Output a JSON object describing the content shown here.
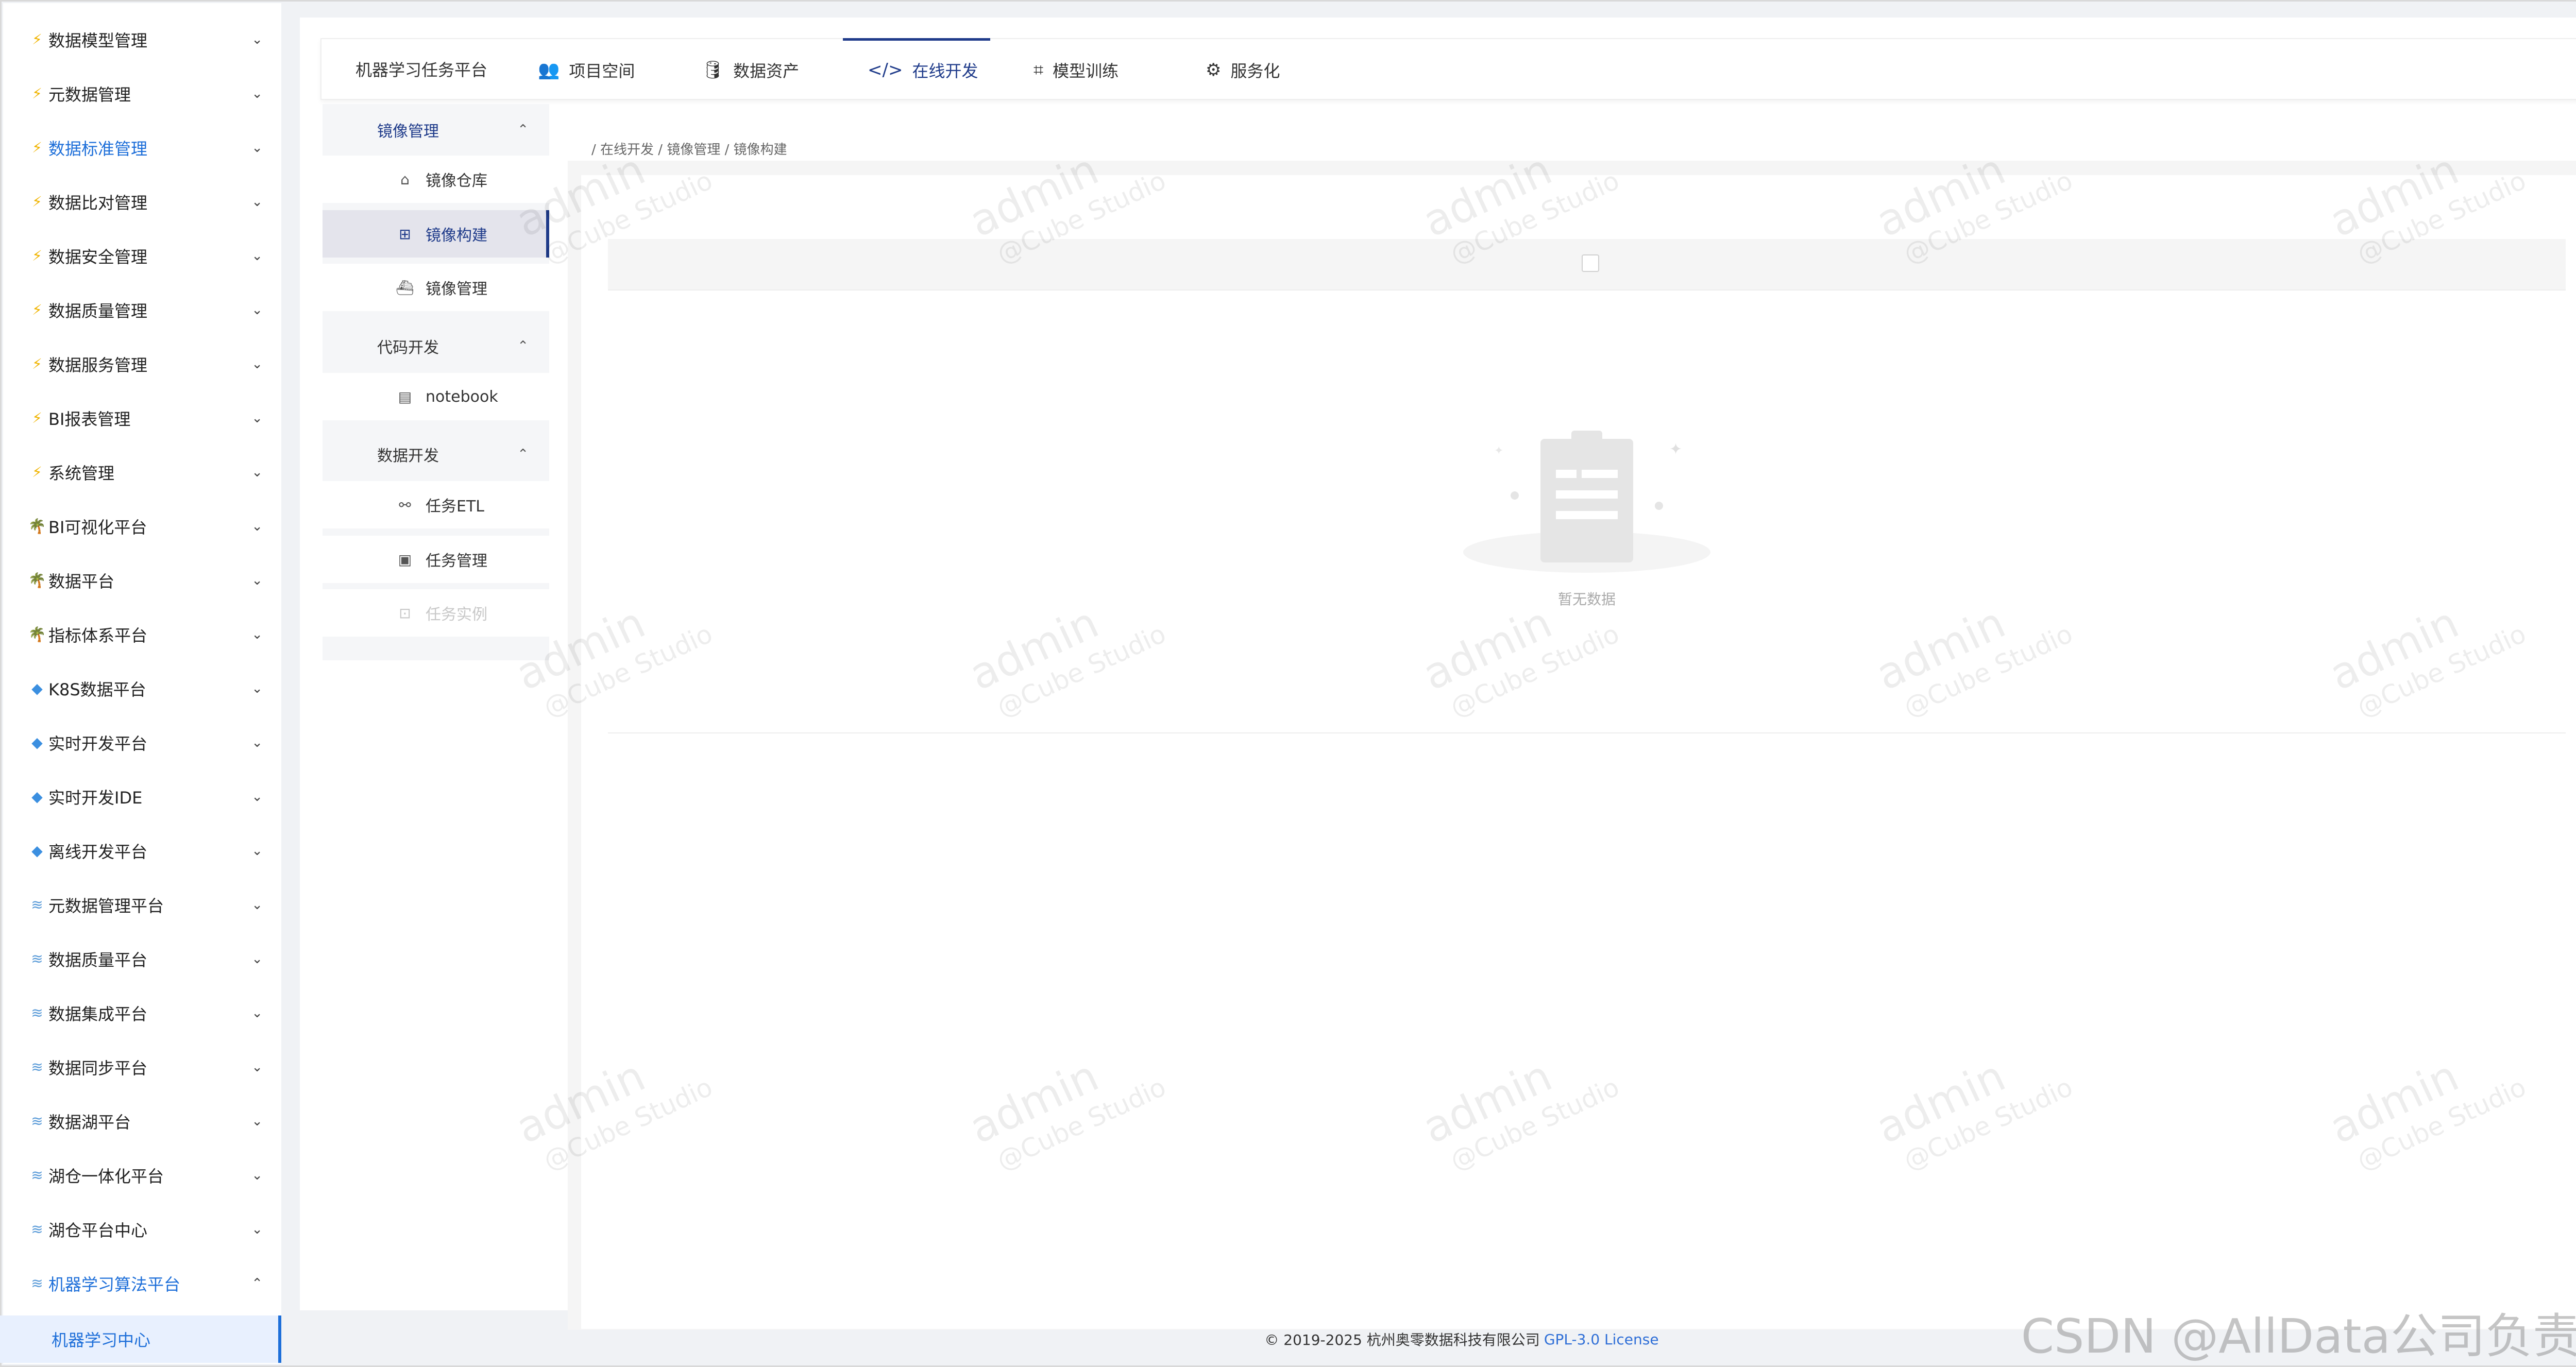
{
  "sidebar": {
    "items": [
      {
        "label": "数据模型管理",
        "icon": "lightning-icon"
      },
      {
        "label": "元数据管理",
        "icon": "lightning-icon"
      },
      {
        "label": "数据标准管理",
        "icon": "lightning-icon"
      },
      {
        "label": "数据比对管理",
        "icon": "lightning-icon"
      },
      {
        "label": "数据安全管理",
        "icon": "lightning-icon"
      },
      {
        "label": "数据质量管理",
        "icon": "lightning-icon"
      },
      {
        "label": "数据服务管理",
        "icon": "lightning-icon"
      },
      {
        "label": "BI报表管理",
        "icon": "lightning-icon"
      },
      {
        "label": "系统管理",
        "icon": "lightning-icon"
      },
      {
        "label": "BI可视化平台",
        "icon": "palm-tree-icon"
      },
      {
        "label": "数据平台",
        "icon": "palm-tree-icon"
      },
      {
        "label": "指标体系平台",
        "icon": "palm-tree-icon"
      },
      {
        "label": "K8S数据平台",
        "icon": "diamond-icon"
      },
      {
        "label": "实时开发平台",
        "icon": "diamond-icon"
      },
      {
        "label": "实时开发IDE",
        "icon": "diamond-icon"
      },
      {
        "label": "离线开发平台",
        "icon": "diamond-icon"
      },
      {
        "label": "元数据管理平台",
        "icon": "stack-icon"
      },
      {
        "label": "数据质量平台",
        "icon": "stack-icon"
      },
      {
        "label": "数据集成平台",
        "icon": "stack-icon"
      },
      {
        "label": "数据同步平台",
        "icon": "stack-icon"
      },
      {
        "label": "数据湖平台",
        "icon": "stack-icon"
      },
      {
        "label": "湖仓一体化平台",
        "icon": "stack-icon"
      },
      {
        "label": "湖仓平台中心",
        "icon": "stack-icon"
      },
      {
        "label": "机器学习算法平台",
        "icon": "stack-icon"
      }
    ],
    "sub_item": "机器学习中心"
  },
  "topnav": {
    "brand": "机器学习任务平台",
    "tabs": [
      {
        "label": "项目空间",
        "icon": "people-icon"
      },
      {
        "label": "数据资产",
        "icon": "database-icon"
      },
      {
        "label": "在线开发",
        "icon": "code-icon"
      },
      {
        "label": "模型训练",
        "icon": "training-icon"
      },
      {
        "label": "服务化",
        "icon": "service-icon"
      }
    ]
  },
  "submenu": {
    "groups": [
      {
        "label": "镜像管理",
        "items": [
          {
            "label": "镜像仓库",
            "icon": "warehouse-icon"
          },
          {
            "label": "镜像构建",
            "icon": "build-icon"
          },
          {
            "label": "镜像管理",
            "icon": "docker-icon"
          }
        ]
      },
      {
        "label": "代码开发",
        "items": [
          {
            "label": "notebook",
            "icon": "notebook-icon"
          }
        ]
      },
      {
        "label": "数据开发",
        "items": [
          {
            "label": "任务ETL",
            "icon": "etl-icon"
          },
          {
            "label": "任务管理",
            "icon": "task-icon"
          },
          {
            "label": "任务实例",
            "icon": "instance-icon"
          }
        ]
      }
    ]
  },
  "breadcrumb": "/ 在线开发 / 镜像管理 / 镜像构建",
  "empty_text": "暂无数据",
  "watermark": {
    "line1": "admin",
    "line2": "@Cube Studio"
  },
  "footer": {
    "copyright": "© 2019-2025 杭州奥零数据科技有限公司",
    "license": "GPL-3.0 License"
  },
  "csdn_watermark": "CSDN @AllData公司负责人",
  "colors": {
    "accent": "#1e6fd9",
    "active_nav": "#1f3b8a"
  }
}
